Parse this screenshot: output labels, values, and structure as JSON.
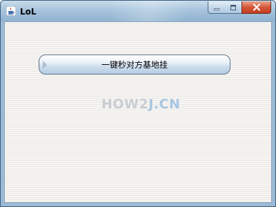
{
  "window": {
    "title": "LoL",
    "app_icon": "java-coffee-cup-icon",
    "controls": {
      "minimize_icon": "minimize-icon",
      "maximize_icon": "maximize-icon",
      "close_icon": "close-icon"
    }
  },
  "content": {
    "action_button_label": "一键秒对方基地挂",
    "watermark_main": "HOW2",
    "watermark_accent": "J.CN"
  },
  "colors": {
    "titlebar": "#a7c4dc",
    "close_button": "#d4573a",
    "client_background": "#f2f1ee",
    "button_gradient_bottom": "#b4cbe2",
    "watermark": "#c9cdd3",
    "watermark_accent": "#a8c6e3"
  }
}
